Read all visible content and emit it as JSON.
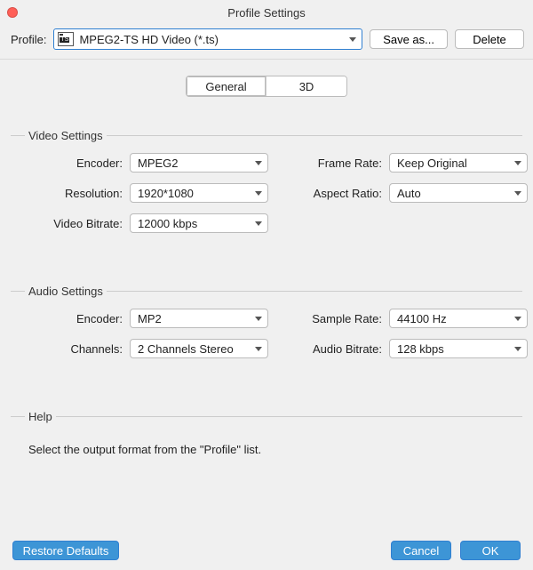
{
  "window": {
    "title": "Profile Settings"
  },
  "profile_bar": {
    "label": "Profile:",
    "selected": "MPEG2-TS HD Video (*.ts)",
    "save_as": "Save as...",
    "delete": "Delete"
  },
  "tabs": {
    "general": "General",
    "three_d": "3D"
  },
  "video": {
    "title": "Video Settings",
    "encoder_label": "Encoder:",
    "encoder_value": "MPEG2",
    "frame_rate_label": "Frame Rate:",
    "frame_rate_value": "Keep Original",
    "resolution_label": "Resolution:",
    "resolution_value": "1920*1080",
    "aspect_label": "Aspect Ratio:",
    "aspect_value": "Auto",
    "bitrate_label": "Video Bitrate:",
    "bitrate_value": "12000 kbps"
  },
  "audio": {
    "title": "Audio Settings",
    "encoder_label": "Encoder:",
    "encoder_value": "MP2",
    "sample_label": "Sample Rate:",
    "sample_value": "44100 Hz",
    "channels_label": "Channels:",
    "channels_value": "2 Channels Stereo",
    "bitrate_label": "Audio Bitrate:",
    "bitrate_value": "128 kbps"
  },
  "help": {
    "title": "Help",
    "text": "Select the output format from the \"Profile\" list."
  },
  "footer": {
    "restore": "Restore Defaults",
    "cancel": "Cancel",
    "ok": "OK"
  }
}
